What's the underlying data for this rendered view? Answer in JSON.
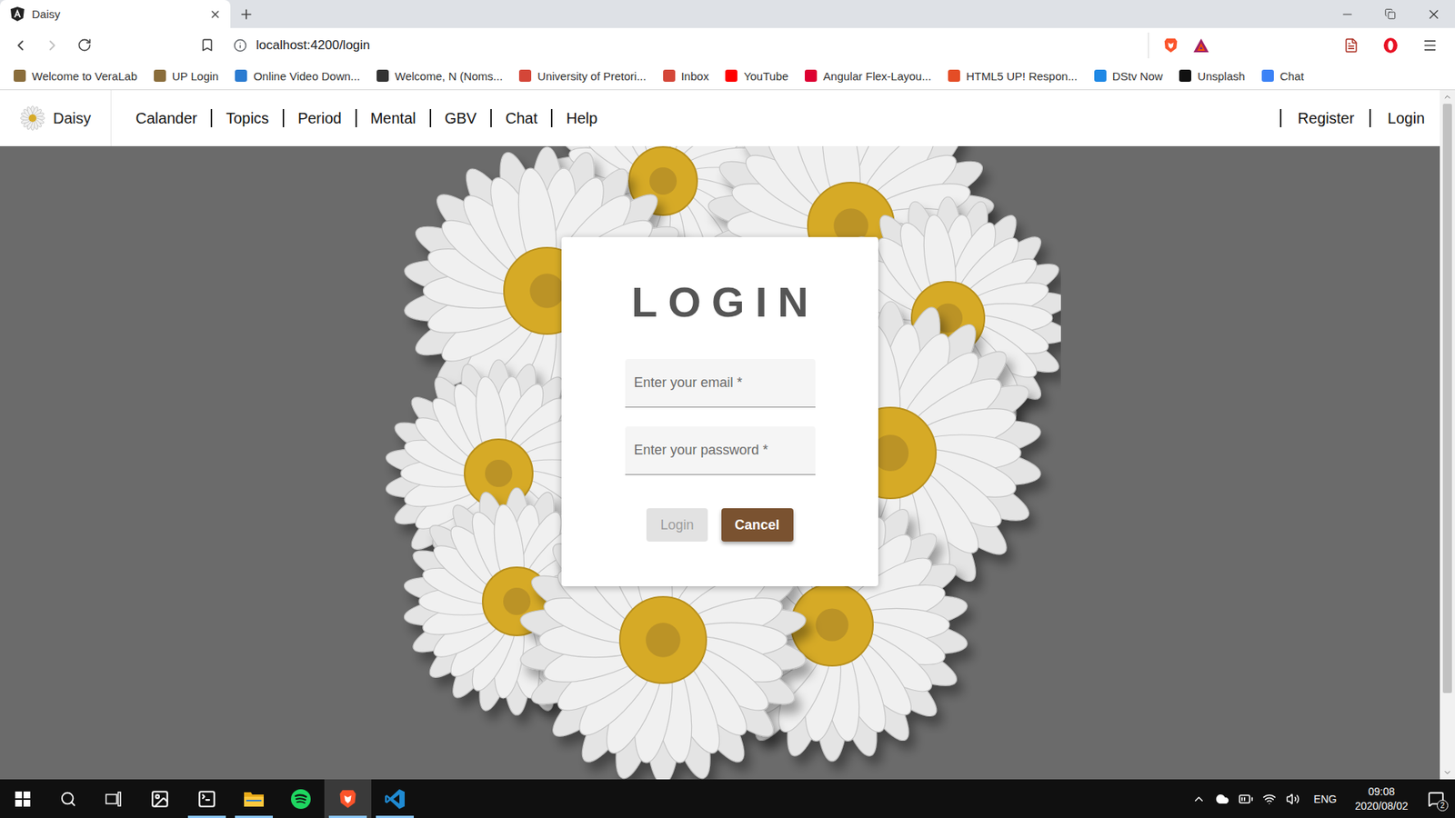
{
  "browser": {
    "tabs": [
      {
        "title": "Daisy",
        "selected": true
      }
    ],
    "navigation": {
      "back_enabled": true,
      "forward_enabled": false
    },
    "address": "localhost:4200/login",
    "bookmarks": [
      {
        "label": "Welcome to VeraLab",
        "color": "#8a6d3b"
      },
      {
        "label": "UP Login",
        "color": "#8a6d3b"
      },
      {
        "label": "Online Video Down...",
        "color": "#2a7bd1"
      },
      {
        "label": "Welcome, N (Noms...",
        "color": "#333333"
      },
      {
        "label": "University of Pretori...",
        "color": "#d44638"
      },
      {
        "label": "Inbox",
        "color": "#d44638"
      },
      {
        "label": "YouTube",
        "color": "#ff0000"
      },
      {
        "label": "Angular Flex-Layou...",
        "color": "#dd0031"
      },
      {
        "label": "HTML5 UP! Respon...",
        "color": "#e44d26"
      },
      {
        "label": "DStv Now",
        "color": "#1e88e5"
      },
      {
        "label": "Unsplash",
        "color": "#111111"
      },
      {
        "label": "Chat",
        "color": "#3b82f6"
      }
    ]
  },
  "page": {
    "nav": {
      "brand": "Daisy",
      "links": [
        "Calander",
        "Topics",
        "Period",
        "Mental",
        "GBV",
        "Chat",
        "Help"
      ],
      "account_links": [
        "Register",
        "Login"
      ]
    },
    "login": {
      "title": "LOGIN",
      "fields": [
        {
          "placeholder": "Enter your email *",
          "kind": "email"
        },
        {
          "placeholder": "Enter your password *",
          "kind": "password"
        }
      ],
      "buttons": [
        {
          "label": "Login",
          "disabled": true,
          "kind": "secondary"
        },
        {
          "label": "Cancel",
          "disabled": false,
          "kind": "primary"
        }
      ]
    },
    "scrollbar": {
      "level": 0.89
    }
  },
  "taskbar": {
    "apps": [
      {
        "kind": "photos",
        "running": false,
        "selected": false
      },
      {
        "kind": "terminal",
        "running": true,
        "selected": false
      },
      {
        "kind": "files",
        "running": true,
        "selected": false
      },
      {
        "kind": "spotify",
        "running": false,
        "selected": false
      },
      {
        "kind": "brave",
        "running": true,
        "selected": true
      },
      {
        "kind": "vscode",
        "running": true,
        "selected": false
      }
    ],
    "tray": {
      "language": "ENG",
      "time": "09:08",
      "date": "2020/08/02",
      "notifications": "2"
    }
  }
}
